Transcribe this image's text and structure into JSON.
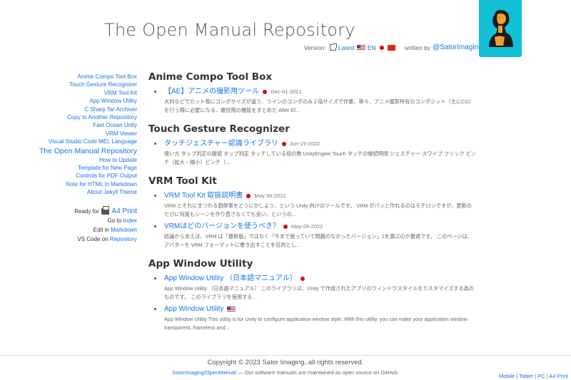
{
  "header": {
    "title": "The Open Manual Repository",
    "version_label": "Version:",
    "latest_link": "Latest",
    "lang_en": "EN",
    "written_by": "written by",
    "author_link": "@SatorImaging"
  },
  "sidebar": {
    "items": [
      {
        "label": "Anime Compo Tool Box"
      },
      {
        "label": "Touch Gesture Recognizer"
      },
      {
        "label": "VRM Tool Kit"
      },
      {
        "label": "App Window Utility"
      },
      {
        "label": "C Sharp Tar Archiver"
      },
      {
        "label": "Copy to Another Repository"
      },
      {
        "label": "Fast Ocean Unity"
      },
      {
        "label": "VRM Viewer"
      },
      {
        "label": "Visual Studio Code MEL Language"
      },
      {
        "label": "The Open Manual Repository"
      },
      {
        "label": "How to Update"
      },
      {
        "label": "Template for New Page"
      },
      {
        "label": "Controls for PDF Output"
      },
      {
        "label": "Note for HTML in Markdown"
      },
      {
        "label": "About Jekyll Theme"
      }
    ],
    "tools": {
      "ready_for": "Ready for",
      "a4_print": "A4 Print",
      "go_to": "Go to",
      "index": "Index",
      "edit_in": "Edit in",
      "markdown": "Markdown",
      "vscode_on": "VS Code on",
      "repository": "Repository"
    }
  },
  "sections": [
    {
      "title": "Anime Compo Tool Box",
      "posts": [
        {
          "title": "【AE】アニメの撮影用ツール",
          "date": "Dec-01-2021",
          "flag": "jp",
          "excerpt": "大判などでカット毎にコンポサイズが違う、ラインのコンポのみ２倍サイズで作業、等々、アニメ撮影特有のコンポジット（主にCG）を行う際に必要になる、最低限の機能をまとめた After Ef..."
        }
      ]
    },
    {
      "title": "Touch Gesture Recognizer",
      "posts": [
        {
          "title": "タッチジェスチャー認識ライブラリ",
          "date": "Jun-19-2022",
          "flag": "jp",
          "excerpt": "使い方 タップ判定の閾値 タップ判定 タッチしている指の数 UnityEngine.Touch タッチの継続時間 ジェスチャー スワイプ フリック ピンチ（拡大・縮小）ピンチ（..."
        }
      ]
    },
    {
      "title": "VRM Tool Kit",
      "posts": [
        {
          "title": "VRM Tool Kit 取扱説明書",
          "date": "May-30-2022",
          "flag": "jp",
          "excerpt": "VRM とそれにまつわる面倒事をどうにかしよう、という Unity 向けのツールです。 VRM がパッと作れるのはモチロンですが、更新のたびに何度もシーンを作り直さなくても良い、というの..."
        },
        {
          "title": "VRMはどのバージョンを使うべき？",
          "date": "May-26-2022",
          "flag": "jp",
          "excerpt": "結論から言えば、VRM は「最新版」ではなく「今まで使っていて問題のなかったバージョン」1を選ぶのが最適です。 このページは、アバターを VRM フォーマットに書き出すことを目的とし..."
        }
      ]
    },
    {
      "title": "App Window Utility",
      "posts": [
        {
          "title": "App Window Utility （日本語マニュアル）",
          "date": "",
          "flag": "jp",
          "excerpt": "App Window Utility （日本語マニュアル） このライブラリは、Unity で作成されたアプリのウィンドウスタイルをカスタマイズする為のものです。 このライブラリを使用する..."
        },
        {
          "title": "App Window Utility",
          "date": "",
          "flag": "us",
          "excerpt": "App Window Utility This utility is for Unity to configure application window style. With this utility, you can make your application window transparent, frameless and..."
        }
      ]
    }
  ],
  "footer": {
    "copyright": "Copyright © 2023 Sator Imaging, all rights reserved.",
    "repo_link": "SatorImaging/OpenManual",
    "note": " — Our software manuals are maintained as open source on GitHub.",
    "devices": [
      "Mobile",
      "Tablet",
      "PC",
      "A4 Print"
    ]
  },
  "colors": {
    "link": "#1a73e8",
    "logo_bg": "#11c0d6"
  }
}
